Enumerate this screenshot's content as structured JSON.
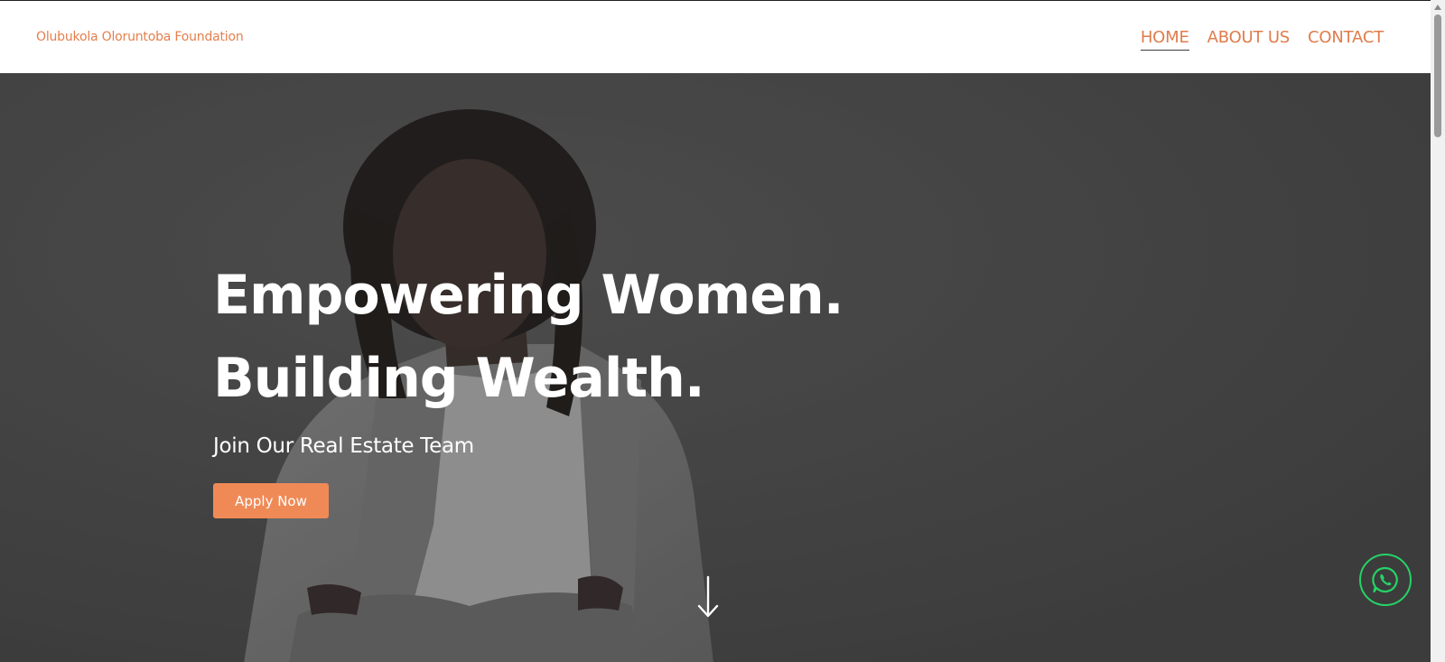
{
  "brand": "Olubukola Oloruntoba Foundation",
  "nav": {
    "items": [
      {
        "label": "HOME",
        "active": true
      },
      {
        "label": "ABOUT US",
        "active": false
      },
      {
        "label": "CONTACT",
        "active": false
      }
    ]
  },
  "hero": {
    "heading": "Empowering Women. Building Wealth.",
    "subheading": "Join Our Real Estate Team",
    "cta_label": "Apply Now"
  },
  "icons": {
    "scroll_down": "arrow-down-icon",
    "whatsapp": "whatsapp-icon"
  },
  "colors": {
    "accent": "#e07c4b",
    "button": "#ef8a57",
    "whatsapp": "#25d366",
    "hero_overlay": "#4a4a4a"
  }
}
